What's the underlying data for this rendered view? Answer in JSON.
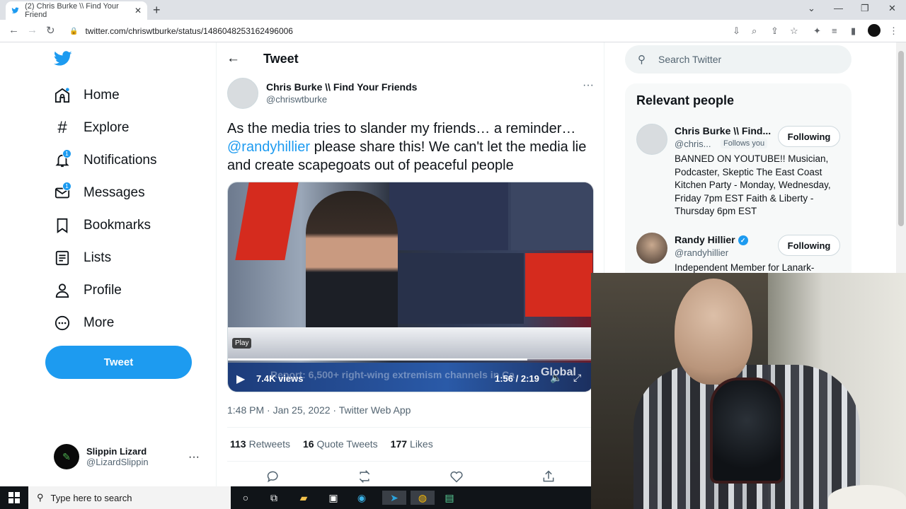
{
  "browser": {
    "tab_title": "(2) Chris Burke \\\\ Find Your Friend",
    "url": "twitter.com/chriswtburke/status/1486048253162496006"
  },
  "nav": {
    "items": [
      {
        "label": "Home"
      },
      {
        "label": "Explore"
      },
      {
        "label": "Notifications",
        "badge": "1"
      },
      {
        "label": "Messages",
        "badge": "1"
      },
      {
        "label": "Bookmarks"
      },
      {
        "label": "Lists"
      },
      {
        "label": "Profile"
      },
      {
        "label": "More"
      }
    ],
    "tweet_button": "Tweet"
  },
  "account": {
    "name": "Slippin Lizard",
    "handle": "@LizardSlippin"
  },
  "page": {
    "title": "Tweet"
  },
  "tweet": {
    "author_name": "Chris Burke \\\\ Find Your Friends",
    "author_handle": "@chriswtburke",
    "text_line1": "As the media tries to slander my friends… a reminder…",
    "mention": "@randyhillier",
    "text_rest": " please share this!  We can't let the media lie and create scapegoats out of peaceful people",
    "video": {
      "play_tag": "Play",
      "views": "7.4K views",
      "ticker": "Report: 6,500+ right-wing extremism channels in Ca",
      "time": "1:56 / 2:19",
      "logo": "Global",
      "progress": 0.82
    },
    "meta": "1:48 PM · Jan 25, 2022 · Twitter Web App",
    "stats": [
      {
        "count": "113",
        "label": "Retweets"
      },
      {
        "count": "16",
        "label": "Quote Tweets"
      },
      {
        "count": "177",
        "label": "Likes"
      }
    ]
  },
  "sidebar": {
    "search_placeholder": "Search Twitter",
    "relevant_title": "Relevant people",
    "people": [
      {
        "name": "Chris Burke \\\\ Find...",
        "handle": "@chris...",
        "follows_you": "Follows you",
        "button": "Following",
        "bio": "BANNED ON YOUTUBE!! Musician, Podcaster, Skeptic The East Coast Kitchen Party - Monday, Wednesday, Friday 7pm EST Faith & Liberty - Thursday 6pm EST"
      },
      {
        "name": "Randy Hillier",
        "handle": "@randyhillier",
        "button": "Following",
        "bio": "Independent Member for Lanark-"
      }
    ]
  },
  "taskbar": {
    "search_placeholder": "Type here to search"
  },
  "colors": {
    "twitter_blue": "#1d9bf0",
    "text": "#0f1419",
    "muted": "#536471"
  }
}
